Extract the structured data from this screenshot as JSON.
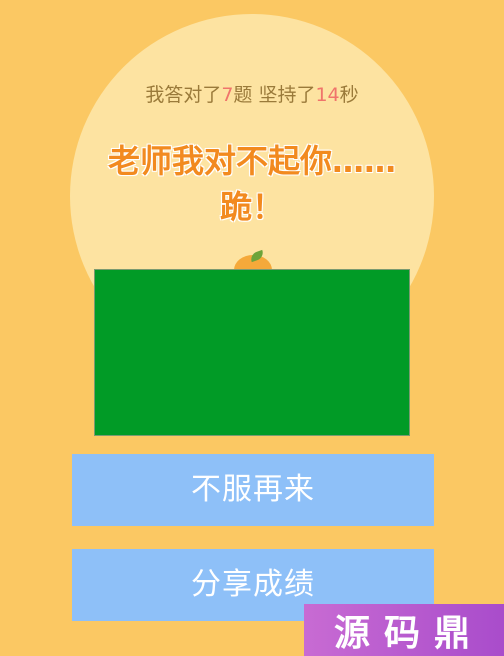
{
  "result": {
    "line_part1": "我答对了",
    "correct_count": "7",
    "line_part2": "题 坚持了",
    "seconds": "14",
    "line_part3": "秒",
    "headline_line1": "老师我对不起你……",
    "headline_line2": "跪！"
  },
  "buttons": {
    "retry_label": "不服再来",
    "share_label": "分享成绩"
  },
  "watermark": {
    "text": "源码鼎"
  },
  "colors": {
    "background": "#fbc863",
    "circle": "#fde3a1",
    "number_accent": "#f0746b",
    "headline": "#f28a1f",
    "green_panel": "#019b26",
    "button": "#8ec0f8"
  }
}
